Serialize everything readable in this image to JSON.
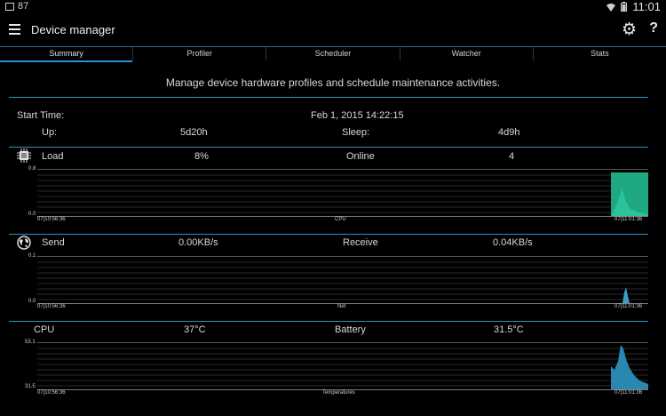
{
  "status_bar": {
    "notif_text": "87",
    "time": "11:01"
  },
  "app": {
    "title": "Device manager"
  },
  "tabs": [
    {
      "label": "Summary",
      "active": true
    },
    {
      "label": "Profiler",
      "active": false
    },
    {
      "label": "Scheduler",
      "active": false
    },
    {
      "label": "Watcher",
      "active": false
    },
    {
      "label": "Stats",
      "active": false
    }
  ],
  "description": "Manage device hardware profiles and schedule maintenance activities.",
  "summary": {
    "start_label": "Start Time:",
    "start_value": "Feb 1, 2015 14:22:15",
    "up_label": "Up:",
    "up_value": "5d20h",
    "sleep_label": "Sleep:",
    "sleep_value": "4d9h"
  },
  "cpu_section": {
    "load_label": "Load",
    "load_value": "8%",
    "online_label": "Online",
    "online_value": "4",
    "chart": {
      "ymax": "0.8",
      "ymin": "0.0",
      "start": "07|10:56:36",
      "end": "07|11:01:36",
      "name": "CPU"
    }
  },
  "net_section": {
    "send_label": "Send",
    "send_value": "0.00KB/s",
    "recv_label": "Receive",
    "recv_value": "0.04KB/s",
    "chart": {
      "ymax": "0.1",
      "ymin": "0.0",
      "start": "07|10:56:36",
      "end": "07|11:01:36",
      "name": "Net"
    }
  },
  "temp_section": {
    "cpu_label": "CPU",
    "cpu_value": "37°C",
    "battery_label": "Battery",
    "battery_value": "31.5°C",
    "chart": {
      "ymax": "53.1",
      "ymin": "31.5",
      "start": "07|10:56:36",
      "end": "07|11:01:36",
      "name": "Temperatures"
    }
  },
  "colors": {
    "accent": "#2f8ec4",
    "cpu_fill": "#1fa882",
    "temp_fill": "#2a88b0",
    "net_fill": "#3aa0c8"
  }
}
